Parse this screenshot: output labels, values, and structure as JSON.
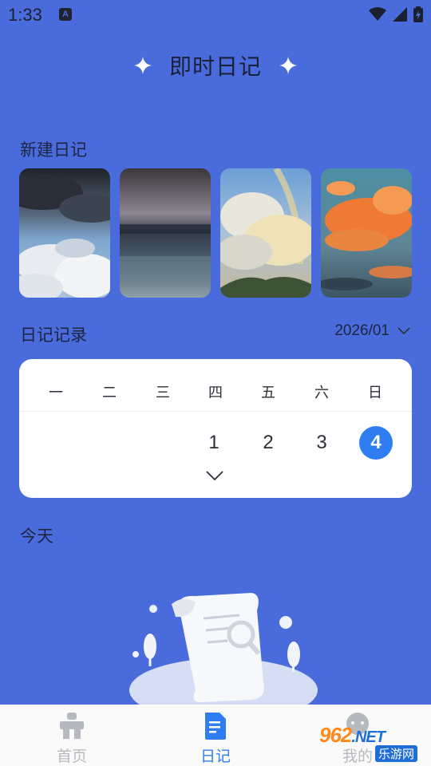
{
  "status_bar": {
    "time": "1:33",
    "notification_letter": "A"
  },
  "header": {
    "title": "即时日记"
  },
  "new_diary": {
    "label": "新建日记",
    "covers": [
      "cloudy-sky",
      "rain-glass",
      "rainbow-clouds",
      "sunset-clouds"
    ]
  },
  "records": {
    "label": "日记记录",
    "month": "2026/01",
    "weekdays": [
      "一",
      "二",
      "三",
      "四",
      "五",
      "六",
      "日"
    ],
    "days": [
      {
        "label": "1",
        "col": 3,
        "selected": false
      },
      {
        "label": "2",
        "col": 4,
        "selected": false
      },
      {
        "label": "3",
        "col": 5,
        "selected": false
      },
      {
        "label": "4",
        "col": 6,
        "selected": true
      }
    ]
  },
  "today": {
    "label": "今天"
  },
  "bottom_nav": {
    "items": [
      {
        "label": "首页",
        "icon": "home-icon"
      },
      {
        "label": "日记",
        "icon": "diary-icon",
        "active": true
      },
      {
        "label": "我的",
        "icon": "profile-icon"
      }
    ]
  },
  "watermark": {
    "brand": "962",
    "suffix": ".NET",
    "site": "乐游网"
  },
  "colors": {
    "background": "#4A6BDC",
    "accent": "#2F7DF0",
    "card": "#FFFFFF"
  }
}
